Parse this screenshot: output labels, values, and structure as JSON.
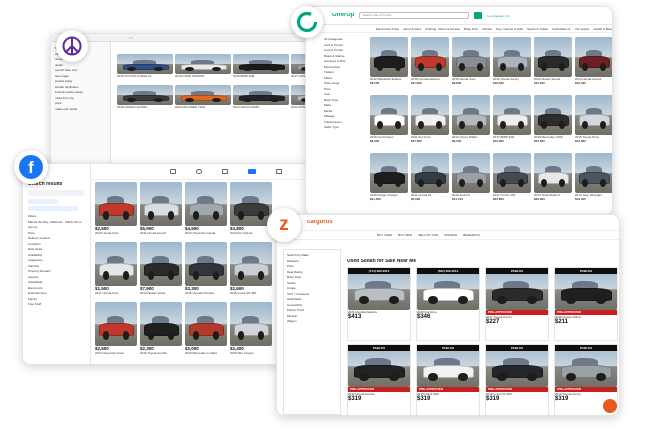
{
  "craigslist": {
    "window_controls": "< >",
    "side_lines": [
      "for sale",
      "cars+trucks",
      "owner",
      "dealer",
      "search titles only",
      "has image",
      "posted today",
      "bundle duplicates",
      "include nearby areas",
      "miles from zip",
      "price",
      "make and model"
    ],
    "listings": [
      {
        "label": "2018 TOYOTA COROLLA",
        "price": "$9,500",
        "color": "#2e4f86"
      },
      {
        "label": "2019 FORD TRANSIT",
        "price": "$24,900",
        "color": "#e8e8e8"
      },
      {
        "label": "2015 BMW 328i",
        "price": "$12,800",
        "color": "#1b1b1b"
      },
      {
        "label": "2017 HONDA CIVIC",
        "price": "$13,200",
        "color": "#9aa3b0"
      },
      {
        "label": "2016 NISSAN ALTIMA",
        "price": "$8,700",
        "color": "#3b3b3b"
      },
      {
        "label": "2020 MCLAREN 720S",
        "price": "$249,000",
        "color": "#e0691c"
      },
      {
        "label": "2014 LEXUS IS250",
        "price": "$11,400",
        "color": "#20252b"
      },
      {
        "label": "2012 PONTIAC G6",
        "price": "$3,900",
        "color": "#b2c0c9"
      }
    ]
  },
  "offerup": {
    "brand": "OfferUp",
    "search_placeholder": "Search Cars & Trucks",
    "location": "Los Angeles, CA",
    "nav": [
      "Electronics & Media",
      "Home & Garden",
      "Clothing, Shoes & Accessories",
      "Baby & Kids",
      "Vehicles",
      "Toys, Games & Hobbies",
      "Sports & Outdoors",
      "Collectibles & Art",
      "Pet supplies",
      "Health & Beauty"
    ],
    "side_lines": [
      "All Categories",
      "Cars & Trucks",
      "Cars & Trucks",
      "Boats & Marine",
      "Campers & RVs",
      "Motorcycles",
      "Trailers",
      "Filters",
      "Price range",
      "Price",
      "Year",
      "Body Type",
      "Make",
      "Model",
      "Mileage",
      "Transmission",
      "Seller Type"
    ],
    "listings": [
      {
        "label": "2012 Mitsubishi Eclipse",
        "price": "$6,500",
        "color": "#1d1d1d"
      },
      {
        "label": "2018 Hyundai Elantra",
        "price": "$11,900",
        "color": "#c0392b"
      },
      {
        "label": "2015 Honda Civic",
        "price": "$9,800",
        "color": "#8a8f96"
      },
      {
        "label": "2019 Toyota Camry",
        "price": "$18,500",
        "color": "#a9b4bf"
      },
      {
        "label": "2020 Nissan Sentra",
        "price": "$15,200",
        "color": "#2a2a2a"
      },
      {
        "label": "2014 Honda Accord",
        "price": "$10,400",
        "color": "#6e1f24"
      },
      {
        "label": "2016 Ford Fusion",
        "price": "$9,300",
        "color": "#ffffff"
      },
      {
        "label": "2021 Kia Forte",
        "price": "$17,600",
        "color": "#f1f1f1"
      },
      {
        "label": "2013 Chevy Malibu",
        "price": "$6,200",
        "color": "#b5b9be"
      },
      {
        "label": "2017 BMW 320i",
        "price": "$16,900",
        "color": "#eeeeee"
      },
      {
        "label": "2019 Mercedes C300",
        "price": "$27,500",
        "color": "#2c2c2c"
      },
      {
        "label": "2015 Toyota Prius",
        "price": "$12,300",
        "color": "#d3d8dd"
      },
      {
        "label": "2018 Dodge Charger",
        "price": "$21,000",
        "color": "#1e1e1e"
      },
      {
        "label": "2011 Honda Fit",
        "price": "$5,900",
        "color": "#353b42"
      },
      {
        "label": "2016 Audi A4",
        "price": "$14,700",
        "color": "#9aa0a6"
      },
      {
        "label": "2017 Ford F-150",
        "price": "$23,800",
        "color": "#444a50"
      },
      {
        "label": "2019 Tesla Model 3",
        "price": "$29,900",
        "color": "#e8e8e8"
      },
      {
        "label": "2014 Jeep Wrangler",
        "price": "$19,400",
        "color": "#4a5560"
      }
    ]
  },
  "facebook": {
    "title": "Search results",
    "side_lines": [
      "Filters",
      "Marina del Rey, California · Within 40 mi",
      "Sort by",
      "Price",
      "Delivery method",
      "Condition",
      "Date listed",
      "Availability",
      "Categories",
      "Vehicles",
      "Property Rentals",
      "Apparel",
      "Classifieds",
      "Electronics",
      "Entertainment",
      "Family",
      "Free Stuff"
    ],
    "listings": [
      {
        "label": "2010 Honda Civic",
        "price": "$2,500",
        "color": "#c0392b"
      },
      {
        "label": "2011 Honda Accord",
        "price": "$5,900",
        "color": "#d9dde1"
      },
      {
        "label": "2013 Chevrolet Impala",
        "price": "$4,500",
        "color": "#a0a7ad"
      },
      {
        "label": "2012 Kia Optima",
        "price": "$3,800",
        "color": "#3b3b3b"
      },
      {
        "label": "2017 Honda Civic",
        "price": "$1,500",
        "color": "#e3e6e9"
      },
      {
        "label": "2013 Nissan Versa",
        "price": "$7,900",
        "color": "#2a2a2a"
      },
      {
        "label": "2015 Hyundai Sonata",
        "price": "$3,300",
        "color": "#31363c"
      },
      {
        "label": "2015 Lexus RX 350",
        "price": "$2,600",
        "color": "#c8cdd2"
      },
      {
        "label": "2014 Chevrolet Cruze",
        "price": "$2,500",
        "color": "#c0392b"
      },
      {
        "label": "2016 Toyota Corolla",
        "price": "$2,300",
        "color": "#1f1f1f"
      },
      {
        "label": "2010 Mercedes C-Class",
        "price": "$2,000",
        "color": "#b33a2b"
      },
      {
        "label": "2016 Mini Cooper",
        "price": "$2,400",
        "color": "#d0d4d8"
      }
    ]
  },
  "cargurus": {
    "brand": "cargurus",
    "nav": [
      "BUY USED",
      "BUY NEW",
      "SELL MY CAR",
      "FINANCE",
      "RESEARCH"
    ],
    "heading": "Used Sedan for Sale Near Me",
    "side_lines": [
      "Search by Make",
      "Distance",
      "Price",
      "Deal Rating",
      "Body Style",
      "Sedan",
      "Coupe",
      "SUV / Crossover",
      "Hatchback",
      "Convertible",
      "Pickup Truck",
      "Minivan",
      "Wagon"
    ],
    "listings": [
      {
        "label": "2021 Hyundai Elantra",
        "price": "$413",
        "dealer": "(714) 930-2212",
        "color": "#b9bec3",
        "banner": ""
      },
      {
        "label": "2020 Kia Forte",
        "price": "$346",
        "dealer": "(562) 262-2212",
        "color": "#ffffff",
        "banner": ""
      },
      {
        "label": "2017 Toyota Camry",
        "price": "$227",
        "dealer": "PABLOS",
        "color": "#2b2b2b",
        "banner": "PRE-APPROVED"
      },
      {
        "label": "2018 Nissan Altima",
        "price": "$211",
        "dealer": "PABLOS",
        "color": "#1f1f1f",
        "banner": "PRE-APPROVED"
      },
      {
        "label": "2019 Honda Accord",
        "price": "$319",
        "dealer": "PABLOS",
        "color": "#222222",
        "banner": "PRE-APPROVED"
      },
      {
        "label": "2015 Infiniti Q50",
        "price": "$319",
        "dealer": "PABLOS",
        "color": "#f2f2f2",
        "banner": "PRE-APPROVED"
      },
      {
        "label": "2016 Lexus IS 200t",
        "price": "$319",
        "dealer": "PABLOS",
        "color": "#23272b",
        "banner": "PRE-APPROVED"
      },
      {
        "label": "2018 Toyota Camry",
        "price": "$319",
        "dealer": "PABLOS",
        "color": "#9aa0a6",
        "banner": "PRE-APPROVED"
      }
    ]
  },
  "colors": {
    "facebook": "#1877f2",
    "offerup": "#00a87e",
    "cargurus": "#e75a1e",
    "craigslist": "#5a2ca0"
  }
}
